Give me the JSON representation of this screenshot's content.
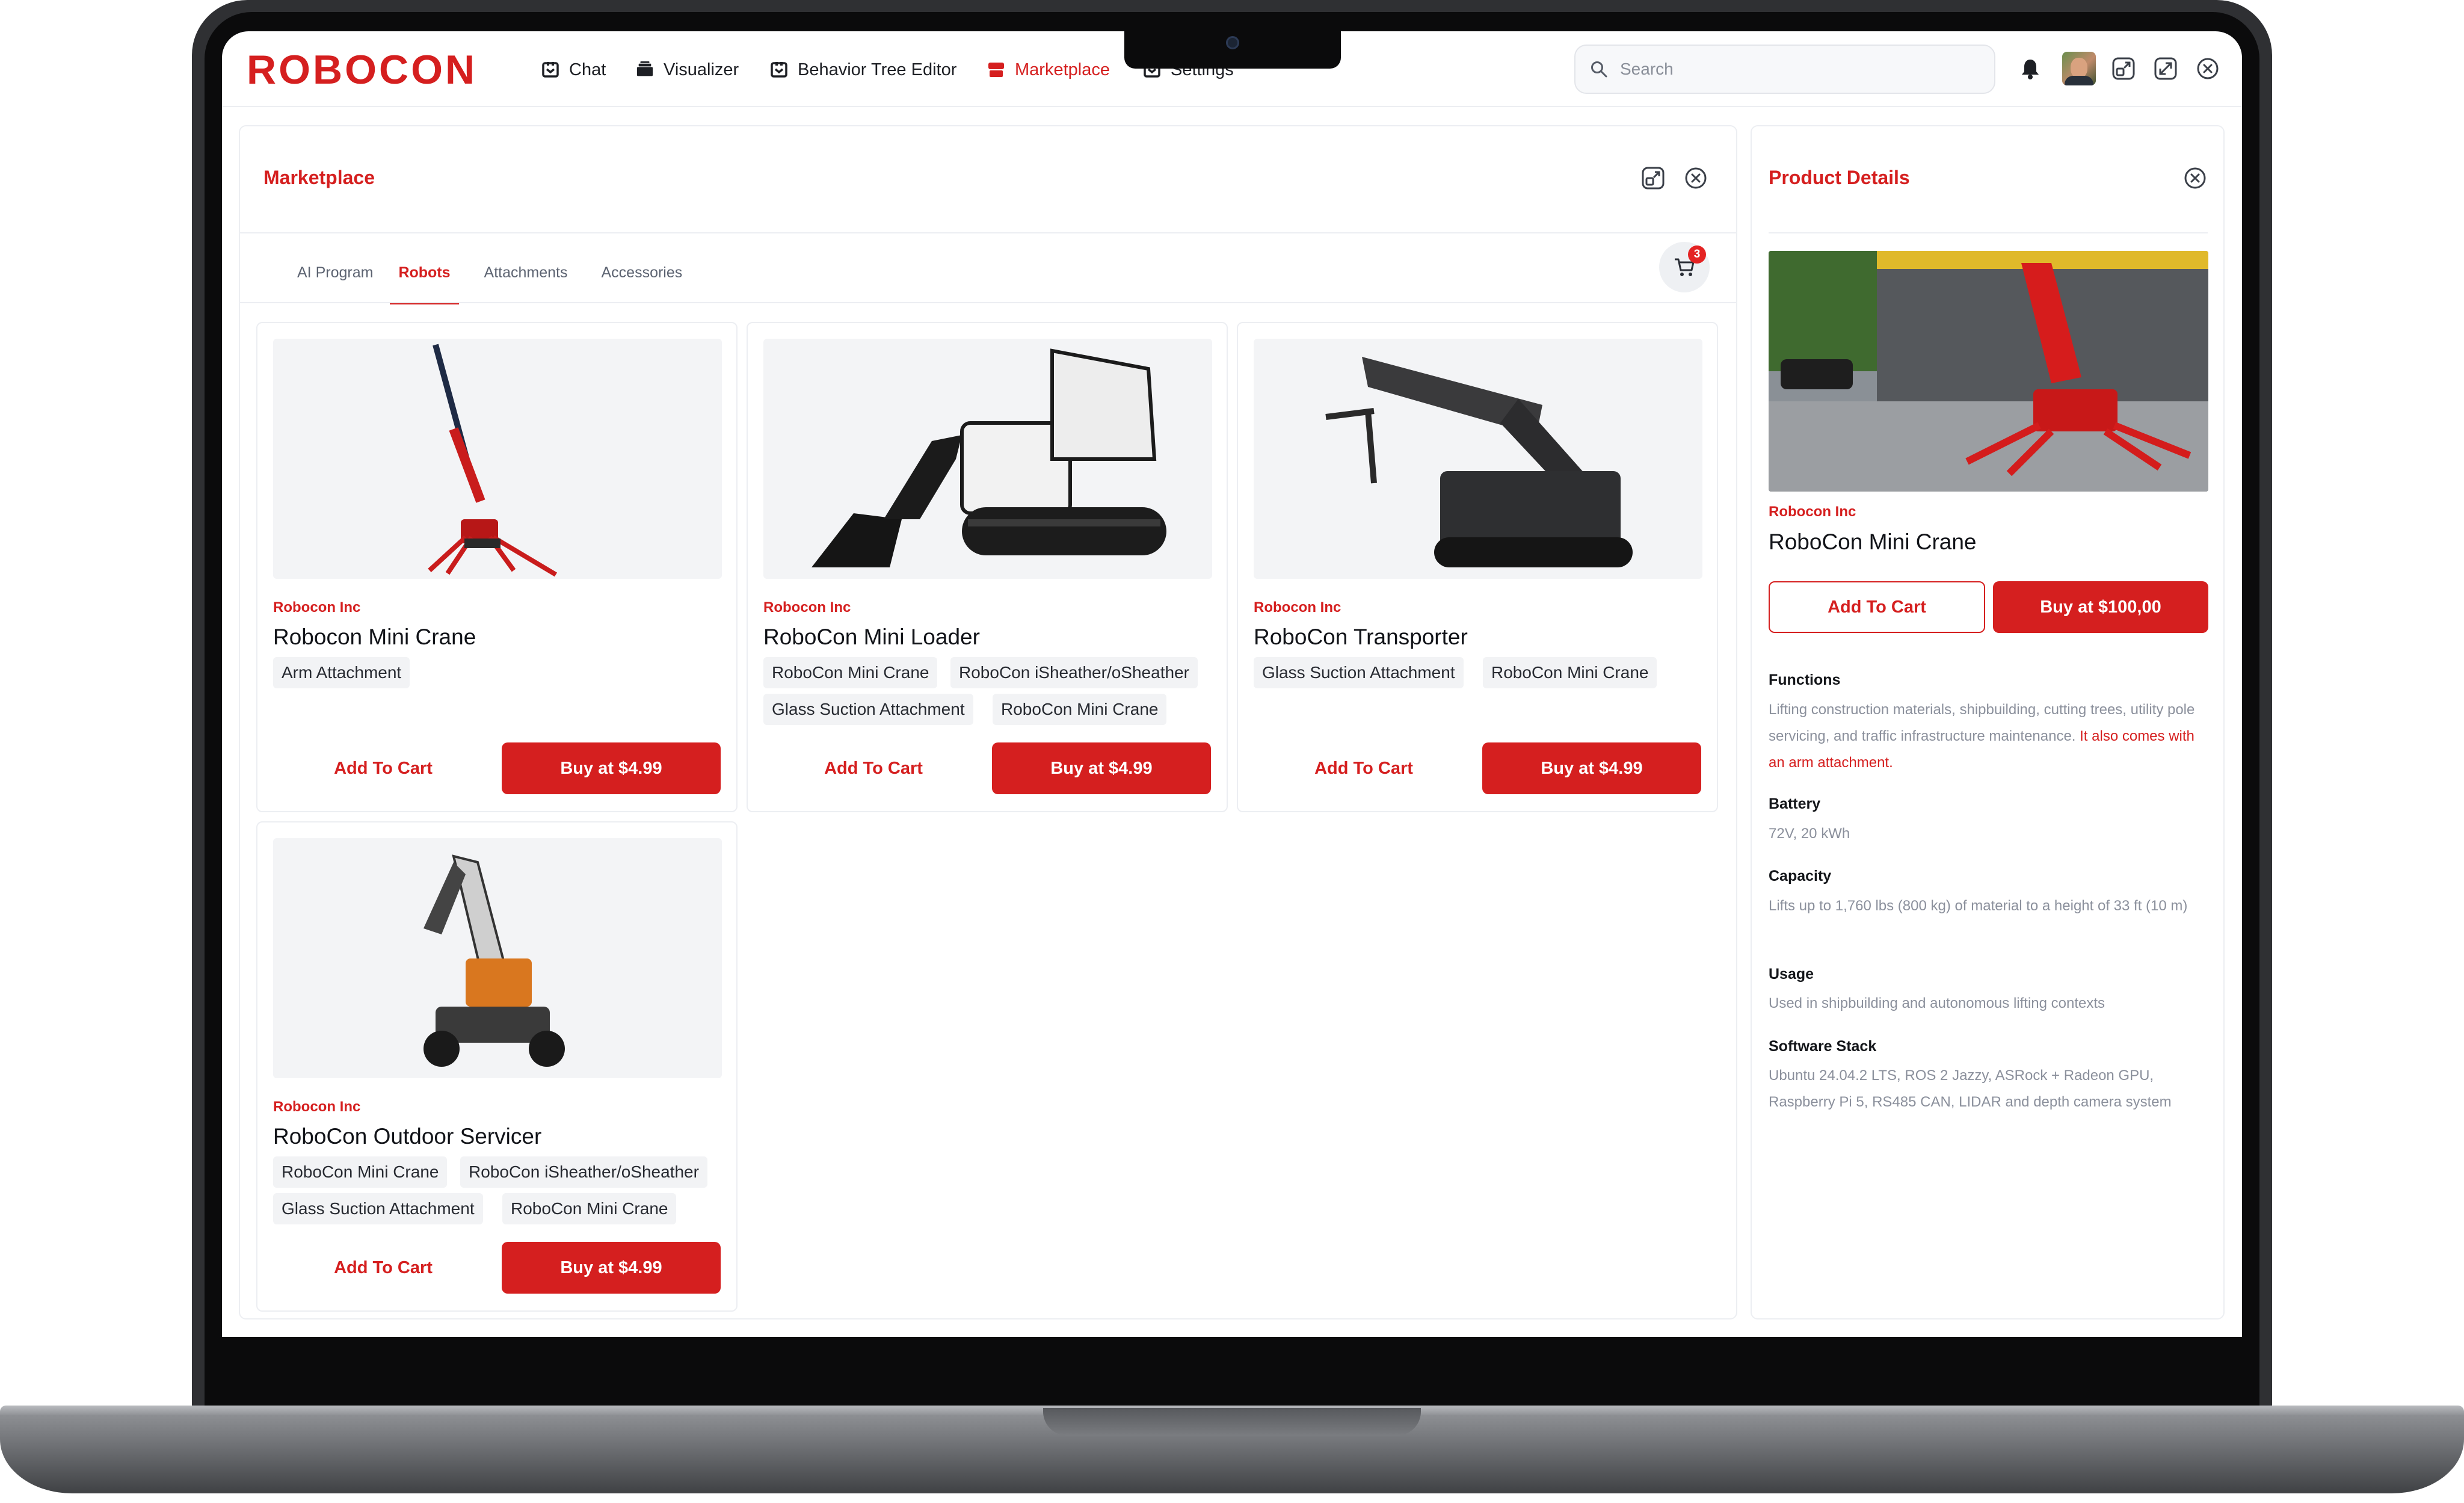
{
  "app": {
    "logo_text": "ROBOCON",
    "brand_color": "#d51f1f"
  },
  "nav": [
    {
      "label": "Chat",
      "icon": "chat-icon"
    },
    {
      "label": "Visualizer",
      "icon": "visualizer-icon"
    },
    {
      "label": "Behavior Tree Editor",
      "icon": "tree-icon"
    },
    {
      "label": "Marketplace",
      "icon": "store-icon",
      "active": true
    },
    {
      "label": "Settings",
      "icon": "gear-icon"
    }
  ],
  "search": {
    "placeholder": "Search"
  },
  "header_icons": [
    "bell-icon",
    "avatar",
    "layout-icon",
    "expand-icon",
    "close-circle-icon"
  ],
  "marketplace": {
    "title": "Marketplace",
    "tabs": [
      "AI Program",
      "Robots",
      "Attachments",
      "Accessories"
    ],
    "active_tab": "Robots",
    "cart_count": "3",
    "products": [
      {
        "vendor": "Robocon Inc",
        "name": "Robocon Mini Crane",
        "tags": [
          "Arm Attachment"
        ],
        "add_label": "Add To Cart",
        "buy_label": "Buy at $4.99"
      },
      {
        "vendor": "Robocon Inc",
        "name": "RoboCon Mini Loader",
        "tags": [
          "RoboCon Mini Crane",
          "RoboCon iSheather/oSheather",
          "Glass Suction Attachment",
          "RoboCon Mini Crane"
        ],
        "add_label": "Add To Cart",
        "buy_label": "Buy at $4.99"
      },
      {
        "vendor": "Robocon Inc",
        "name": "RoboCon Transporter",
        "tags": [
          "Glass Suction Attachment",
          "RoboCon Mini Crane"
        ],
        "add_label": "Add To Cart",
        "buy_label": "Buy at $4.99"
      },
      {
        "vendor": "Robocon Inc",
        "name": "RoboCon Outdoor Servicer",
        "tags": [
          "RoboCon Mini Crane",
          "RoboCon iSheather/oSheather",
          "Glass Suction Attachment",
          "RoboCon Mini Crane"
        ],
        "add_label": "Add To Cart",
        "buy_label": "Buy at $4.99"
      }
    ]
  },
  "details": {
    "title": "Product Details",
    "vendor": "Robocon Inc",
    "name": "RoboCon Mini Crane",
    "add_label": "Add To Cart",
    "buy_label": "Buy at $100,00",
    "functions_label": "Functions",
    "functions_text": "Lifting construction materials, shipbuilding, cutting trees, utility pole servicing, and traffic infrastructure maintenance.",
    "functions_highlight": "It also comes with an arm attachment.",
    "battery_label": "Battery",
    "battery_text": "72V, 20 kWh",
    "capacity_label": "Capacity",
    "capacity_text": "Lifts up to 1,760 lbs (800 kg) of material to a height of 33 ft (10 m)",
    "usage_label": "Usage",
    "usage_text": "Used in shipbuilding and autonomous lifting contexts",
    "software_label": "Software Stack",
    "software_text": "Ubuntu 24.04.2 LTS, ROS 2 Jazzy, ASRock + Radeon GPU, Raspberry Pi 5, RS485 CAN, LIDAR and depth camera system"
  }
}
